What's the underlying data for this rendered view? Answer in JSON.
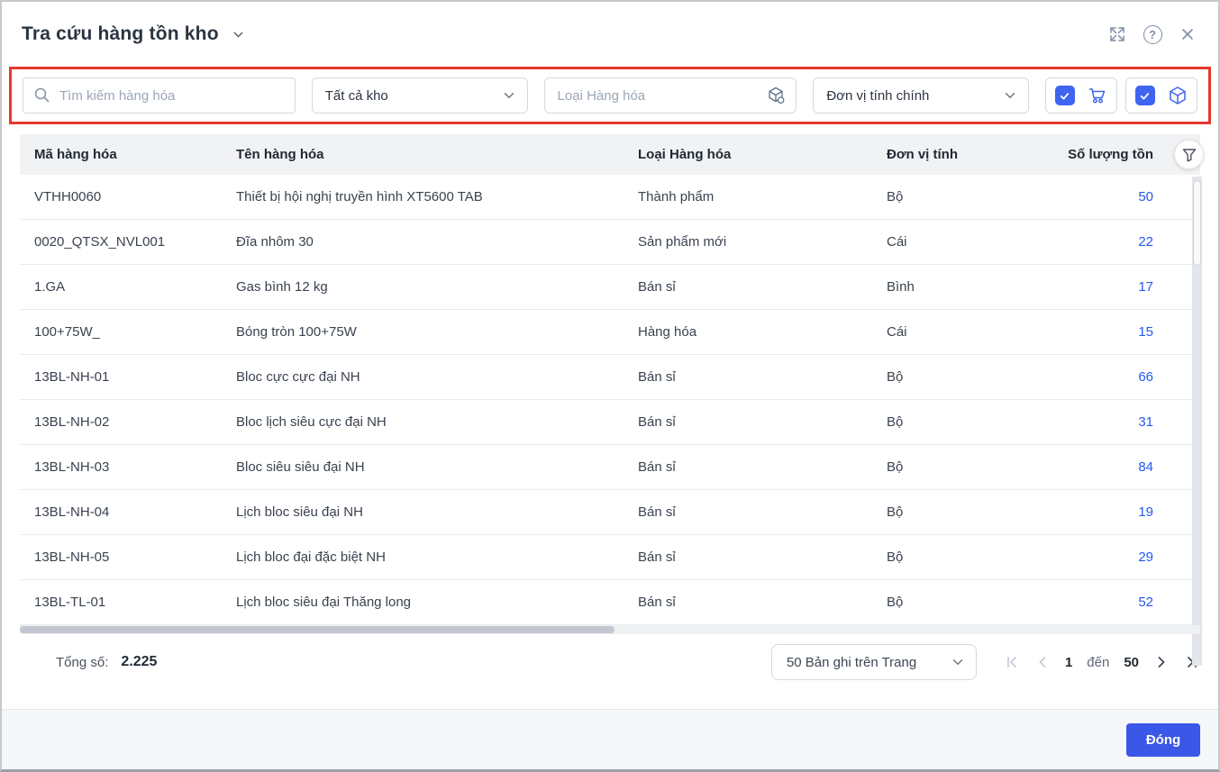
{
  "titlebar": {
    "title": "Tra cứu hàng tồn kho"
  },
  "icons": {
    "help_glyph": "?"
  },
  "filters": {
    "search": {
      "placeholder": "Tìm kiếm hàng hóa",
      "value": ""
    },
    "warehouse": {
      "value": "Tất cả kho"
    },
    "item_type": {
      "placeholder": "Loại Hàng hóa",
      "value": ""
    },
    "unit": {
      "value": "Đơn vị tính chính"
    },
    "cart_checkbox": {
      "checked": true
    },
    "box_checkbox": {
      "checked": true
    }
  },
  "table": {
    "columns": {
      "code": "Mã hàng hóa",
      "name": "Tên hàng hóa",
      "type": "Loại Hàng hóa",
      "unit": "Đơn vị tính",
      "qty": "Số lượng tồn"
    },
    "rows": [
      {
        "code": "VTHH0060",
        "name": "Thiết bị hội nghị truyền hình XT5600 TAB",
        "type": "Thành phẩm",
        "unit": "Bộ",
        "qty": "50"
      },
      {
        "code": "0020_QTSX_NVL001",
        "name": "Đĩa nhôm 30",
        "type": "Sản phẩm mới",
        "unit": "Cái",
        "qty": "22"
      },
      {
        "code": "1.GA",
        "name": "Gas bình 12 kg",
        "type": "Bán sỉ",
        "unit": "Bình",
        "qty": "17"
      },
      {
        "code": "100+75W_",
        "name": "Bóng tròn 100+75W",
        "type": "Hàng hóa",
        "unit": "Cái",
        "qty": "15"
      },
      {
        "code": "13BL-NH-01",
        "name": "Bloc cực cực đại NH",
        "type": "Bán sỉ",
        "unit": "Bộ",
        "qty": "66"
      },
      {
        "code": "13BL-NH-02",
        "name": "Bloc lịch siêu cực đại NH",
        "type": "Bán sỉ",
        "unit": "Bộ",
        "qty": "31"
      },
      {
        "code": "13BL-NH-03",
        "name": "Bloc siêu siêu đại NH",
        "type": "Bán sỉ",
        "unit": "Bộ",
        "qty": "84"
      },
      {
        "code": "13BL-NH-04",
        "name": "Lịch bloc siêu đại NH",
        "type": "Bán sỉ",
        "unit": "Bộ",
        "qty": "19"
      },
      {
        "code": "13BL-NH-05",
        "name": "Lịch bloc đại đặc biệt NH",
        "type": "Bán sỉ",
        "unit": "Bộ",
        "qty": "29"
      },
      {
        "code": "13BL-TL-01",
        "name": "Lịch bloc siêu đại Thăng long",
        "type": "Bán sỉ",
        "unit": "Bộ",
        "qty": "52"
      }
    ]
  },
  "pagination": {
    "total_label": "Tổng số:",
    "total_value": "2.225",
    "page_size_value": "50 Bản ghi trên Trang",
    "page_start": "1",
    "range_separator": "đến",
    "page_end": "50"
  },
  "actions": {
    "close_label": "Đóng"
  },
  "colors": {
    "accent_blue": "#3B57E7",
    "link_blue": "#2458F0",
    "checkbox_blue": "#3E64F0",
    "highlight_red": "#E6392F",
    "header_bg": "#F1F2F4"
  }
}
